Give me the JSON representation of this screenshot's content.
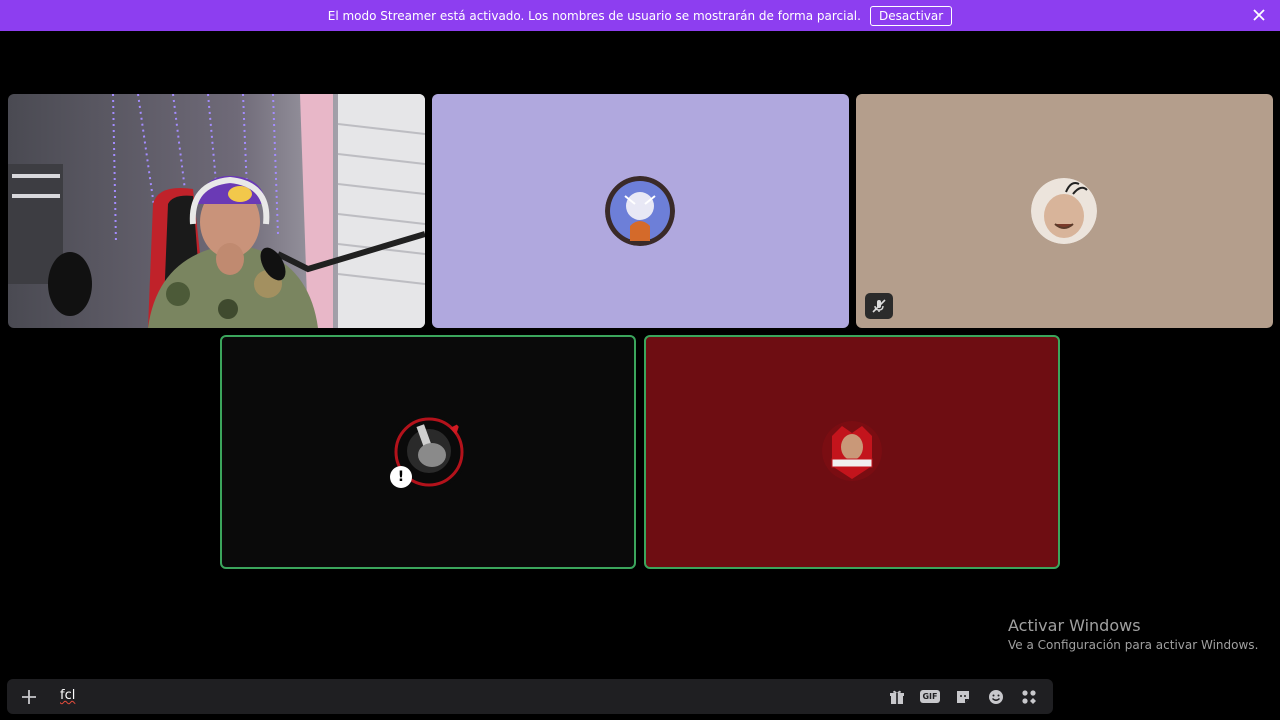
{
  "banner": {
    "message": "El modo Streamer está activado. Los nombres de usuario se mostrarán de forma parcial.",
    "button_label": "Desactivar",
    "color": "#8d3ef0"
  },
  "tiles": [
    {
      "kind": "camera",
      "bg": "#3a3a3a"
    },
    {
      "kind": "avatar",
      "bg": "#b0a8de"
    },
    {
      "kind": "avatar",
      "bg": "#b49e8c",
      "muted": true
    },
    {
      "kind": "avatar",
      "bg": "#0a0a0a",
      "speaking": true,
      "warning_glyph": "!"
    },
    {
      "kind": "avatar",
      "bg": "#6e0d12",
      "speaking": true
    }
  ],
  "speaking_color": "#3ba55c",
  "watermark": {
    "title": "Activar Windows",
    "subtitle": "Ve a Configuración para activar Windows."
  },
  "chat": {
    "input_value": "fcl",
    "icons": [
      "plus-icon",
      "gift-icon",
      "gif-icon",
      "sticker-icon",
      "emoji-icon",
      "apps-icon"
    ],
    "gif_label": "GIF"
  }
}
